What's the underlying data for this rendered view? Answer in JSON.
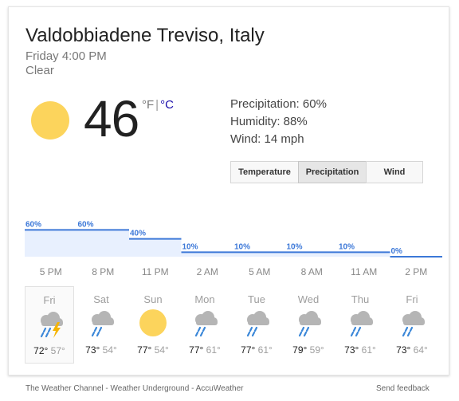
{
  "header": {
    "location": "Valdobbiadene Treviso, Italy",
    "datetime": "Friday 4:00 PM",
    "condition": "Clear"
  },
  "current": {
    "temperature": "46",
    "unit_f": "°F",
    "separator": "|",
    "unit_c": "°C",
    "icon": "sun-icon"
  },
  "details": {
    "precipitation": "Precipitation: 60%",
    "humidity": "Humidity: 88%",
    "wind": "Wind: 14 mph"
  },
  "tabs": [
    {
      "label": "Temperature",
      "selected": false
    },
    {
      "label": "Precipitation",
      "selected": true
    },
    {
      "label": "Wind",
      "selected": false
    }
  ],
  "chart_data": {
    "type": "area",
    "unit": "%",
    "color": "#3c78d8",
    "fill": "#e8f0fe",
    "x": [
      "5 PM",
      "8 PM",
      "11 PM",
      "2 AM",
      "5 AM",
      "8 AM",
      "11 AM",
      "2 PM"
    ],
    "values": [
      60,
      60,
      40,
      10,
      10,
      10,
      10,
      0
    ],
    "value_labels": [
      "60%",
      "60%",
      "40%",
      "10%",
      "10%",
      "10%",
      "10%",
      "0%"
    ],
    "ylim": [
      0,
      100
    ]
  },
  "forecast": [
    {
      "day": "Fri",
      "icon": "thunderstorm-icon",
      "high": "72°",
      "low": "57°",
      "selected": true
    },
    {
      "day": "Sat",
      "icon": "rain-icon",
      "high": "73°",
      "low": "54°",
      "selected": false
    },
    {
      "day": "Sun",
      "icon": "sun-icon",
      "high": "77°",
      "low": "54°",
      "selected": false
    },
    {
      "day": "Mon",
      "icon": "rain-icon",
      "high": "77°",
      "low": "61°",
      "selected": false
    },
    {
      "day": "Tue",
      "icon": "rain-icon",
      "high": "77°",
      "low": "61°",
      "selected": false
    },
    {
      "day": "Wed",
      "icon": "rain-icon",
      "high": "79°",
      "low": "59°",
      "selected": false
    },
    {
      "day": "Thu",
      "icon": "rain-icon",
      "high": "73°",
      "low": "61°",
      "selected": false
    },
    {
      "day": "Fri",
      "icon": "rain-icon",
      "high": "73°",
      "low": "64°",
      "selected": false
    }
  ],
  "footer": {
    "sources": "The Weather Channel - Weather Underground - AccuWeather",
    "feedback": "Send feedback"
  },
  "colors": {
    "sun": "#fcd45c",
    "cloud": "#b5b5b5",
    "rain": "#3a87d8",
    "bolt": "#f5b400",
    "link": "#1a0dab"
  }
}
